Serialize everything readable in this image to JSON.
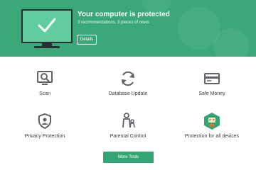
{
  "status": {
    "title": "Your computer is protected",
    "subtitle": "3 recommendations, 3 pieces of news",
    "details_label": "Details"
  },
  "tools": [
    {
      "label": "Scan",
      "icon": "scan-icon"
    },
    {
      "label": "Database Update",
      "icon": "database-update-icon"
    },
    {
      "label": "Safe Money",
      "icon": "safe-money-icon"
    },
    {
      "label": "Privacy Protection",
      "icon": "privacy-protection-icon"
    },
    {
      "label": "Parental Control",
      "icon": "parental-control-icon"
    },
    {
      "label": "Protection for all devices",
      "icon": "protection-all-devices-icon"
    }
  ],
  "more_tools_label": "More Tools",
  "colors": {
    "header_green": "#3aa877",
    "screen_green": "#5fcd9c",
    "button_green": "#2fa673",
    "icon_gray": "#5f6368"
  }
}
